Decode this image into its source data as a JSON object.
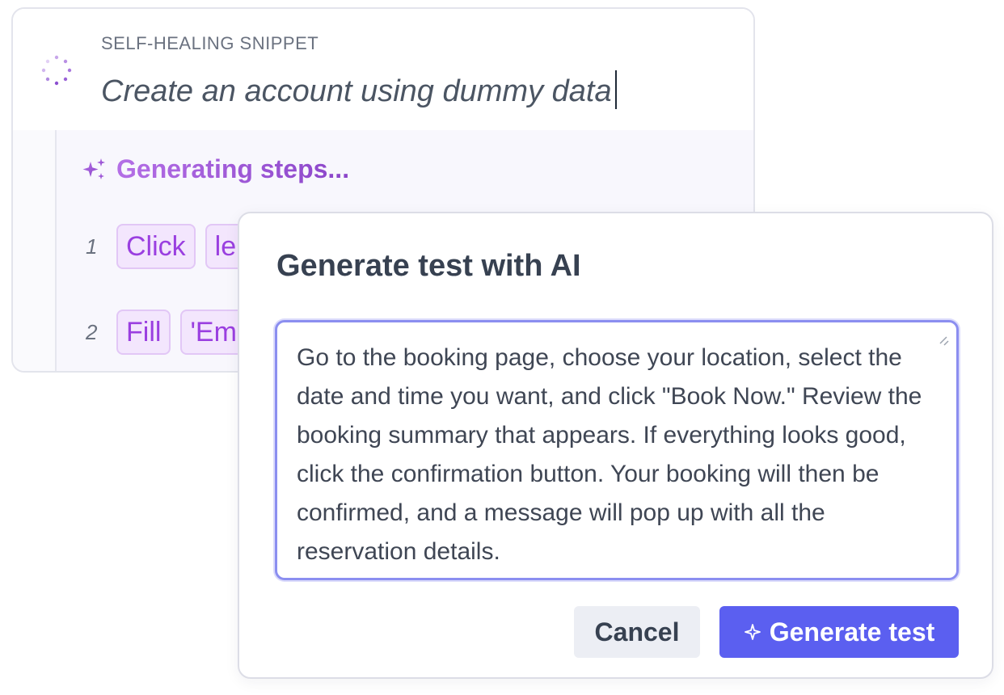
{
  "snippet": {
    "kicker": "SELF-HEALING SNIPPET",
    "prompt": "Create an account using dummy data",
    "status": "Generating steps...",
    "steps": [
      {
        "number": "1",
        "chips": [
          "Click",
          "le"
        ]
      },
      {
        "number": "2",
        "chips": [
          "Fill",
          "'Em"
        ]
      }
    ]
  },
  "dialog": {
    "title": "Generate test with AI",
    "prompt_value": "Go to the booking page, choose your location, select the date and time you want, and click \"Book Now.\" Review the booking summary that appears. If everything looks good, click the confirmation button. Your booking will then be confirmed, and a message will pop up with all the reservation details.",
    "cancel_label": "Cancel",
    "generate_label": "Generate test"
  },
  "icons": {
    "spinner": "loading-spinner-icon",
    "sparkles": "sparkles-icon",
    "sparkle": "sparkle-icon",
    "resize": "resize-grip-icon"
  },
  "colors": {
    "accent": "#5b5ff0",
    "chip_text": "#9a3fe0",
    "chip_bg": "#f3e6fd",
    "status_gradient_start": "#b46fe6",
    "status_gradient_end": "#8b45c9"
  }
}
